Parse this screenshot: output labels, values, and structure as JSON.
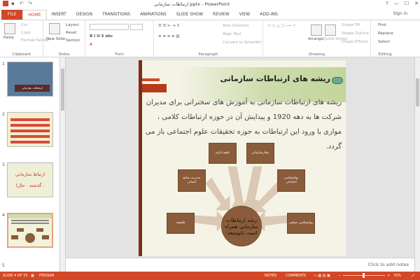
{
  "window": {
    "title": "ارتباطات سازمانی.pptx - PowerPoint",
    "controls": [
      "?",
      "—",
      "☐",
      "✕"
    ],
    "sign_in": "Sign in"
  },
  "tabs": [
    "FILE",
    "HOME",
    "INSERT",
    "DESIGN",
    "TRANSITIONS",
    "ANIMATIONS",
    "SLIDE SHOW",
    "REVIEW",
    "VIEW",
    "ADD-INS"
  ],
  "ribbon": {
    "clipboard": {
      "label": "Clipboard",
      "paste": "Paste",
      "cut": "Cut",
      "copy": "Copy",
      "format_painter": "Format Painter"
    },
    "slides": {
      "label": "Slides",
      "new_slide": "New Slide",
      "layout": "Layout",
      "reset": "Reset",
      "section": "Section"
    },
    "font": {
      "label": "Font"
    },
    "paragraph": {
      "label": "Paragraph",
      "text_direction": "Text Direction",
      "align_text": "Align Text",
      "convert": "Convert to SmartArt"
    },
    "drawing": {
      "label": "Drawing",
      "arrange": "Arrange",
      "quick_styles": "Quick Styles",
      "shape_fill": "Shape Fill",
      "shape_outline": "Shape Outline",
      "shape_effects": "Shape Effects"
    },
    "editing": {
      "label": "Editing",
      "find": "Find",
      "replace": "Replace",
      "select": "Select"
    }
  },
  "thumbnails": [
    {
      "num": "1",
      "text": "ارتباطات سازمانی"
    },
    {
      "num": "2"
    },
    {
      "num": "3",
      "line1": "ارتباط سازمانی",
      "line2": "(گذشته . حال ."
    },
    {
      "num": "4"
    },
    {
      "num": "5"
    }
  ],
  "slide": {
    "title": "ریشه های ارتباطات سازمانی",
    "body": "ریشه های ارتباطات سازمانی به آموزش های سخنرانی برای مدیران شرکت ها به دهه 1920 و پیدایش آن در حوزه ارتباطات کلامی ، موازی با ورود این ارتباطات به حوزه تحقیقات علوم اجتماعی باز می گردد.",
    "nodes": [
      "علوم اداری",
      "رفتارسازمانی",
      "مدیریت منابع انسانی",
      "روانشناسی اجتماعی",
      "فلسفه",
      "روانشناسی صنعتی"
    ],
    "center": "رشد ارتباطات سازمانی همراه است باتوسعه:"
  },
  "notes_placeholder": "Click to add notes",
  "status": {
    "slide_of": "SLIDE 4 OF 53",
    "language": "PERSIAN",
    "notes": "NOTES",
    "comments": "COMMENTS",
    "zoom": "70%"
  }
}
